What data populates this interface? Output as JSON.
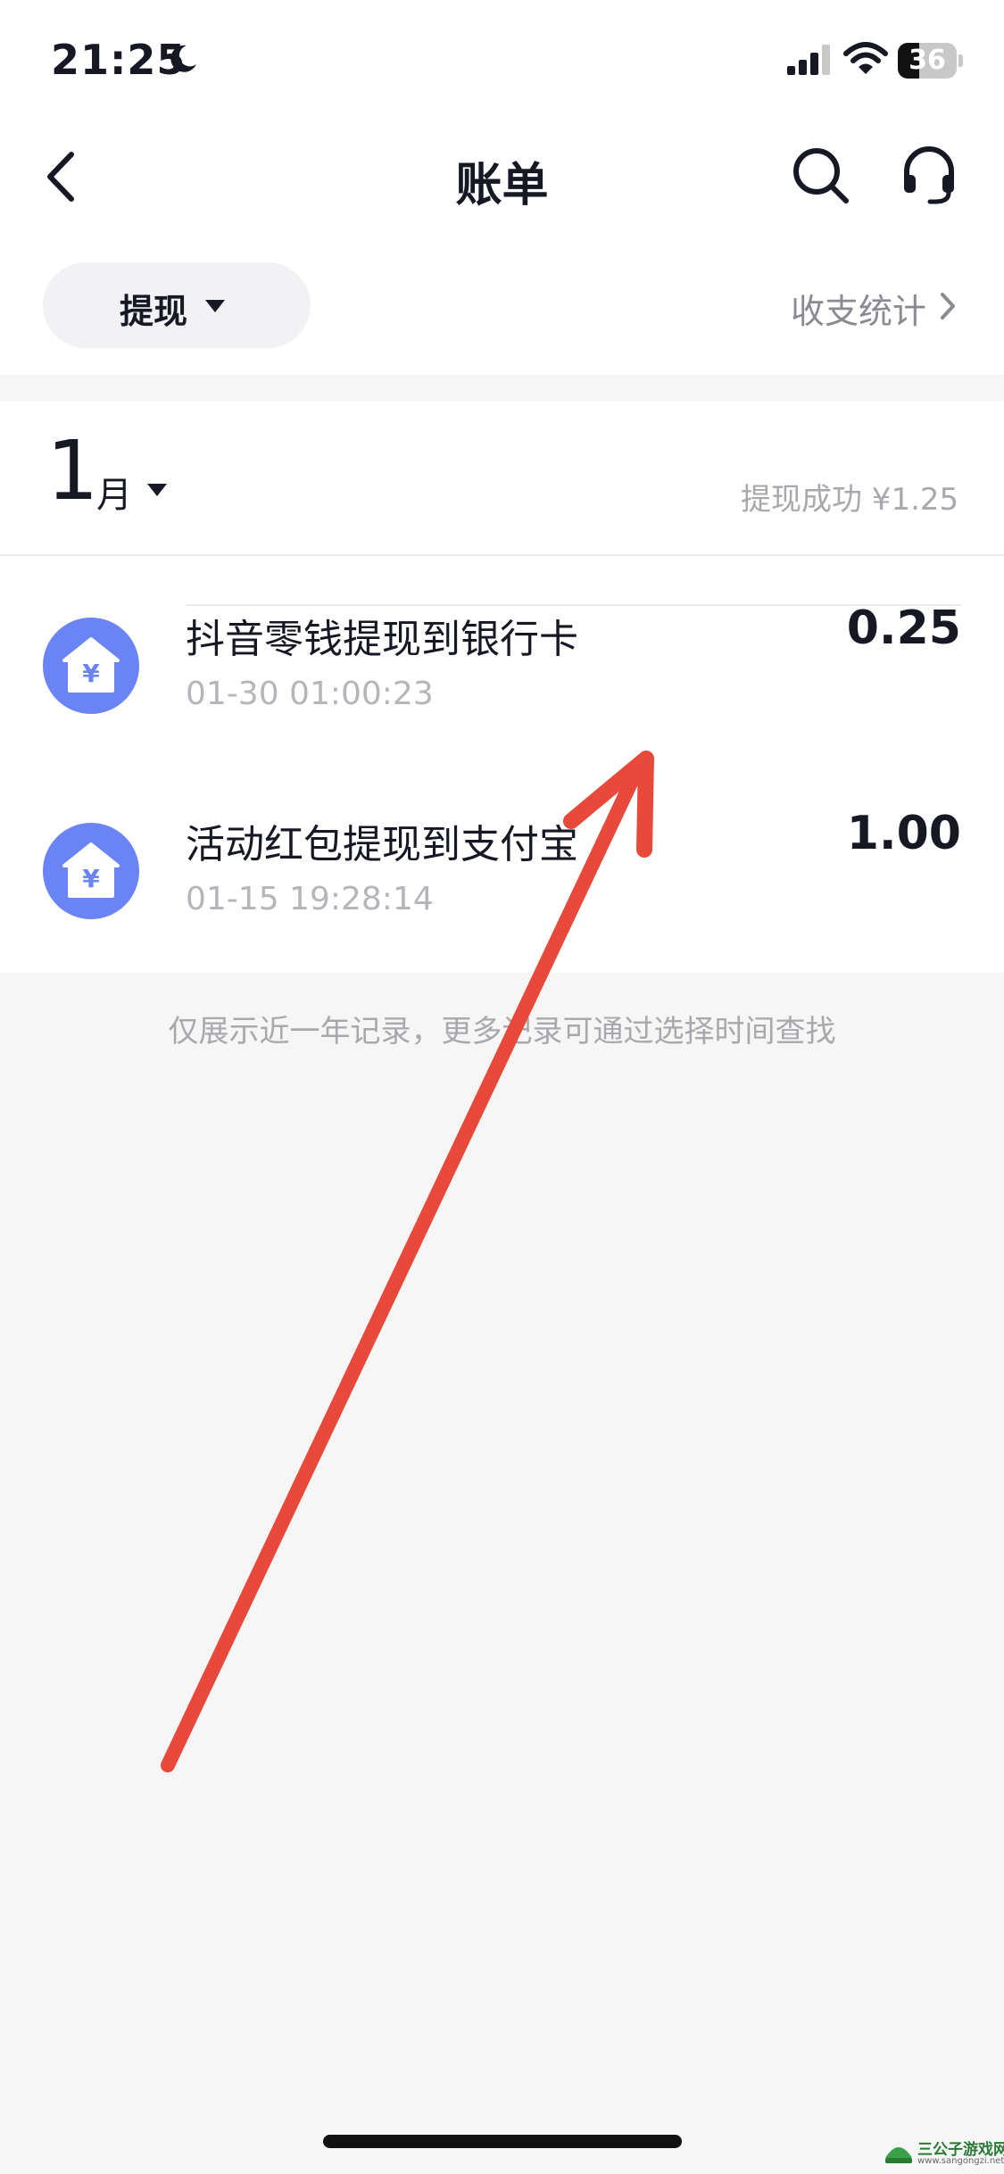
{
  "status_bar": {
    "time": "21:25",
    "battery_level": "36",
    "battery_fraction": 0.36,
    "icons": [
      "moon-icon",
      "cellular-signal-icon",
      "wifi-icon",
      "battery-icon"
    ]
  },
  "nav": {
    "title": "账单",
    "icons": [
      "back-chevron-icon",
      "search-icon",
      "headset-icon"
    ]
  },
  "filter": {
    "selected": "提现",
    "stats_label": "收支统计"
  },
  "month": {
    "number": "1",
    "unit": "月",
    "summary": "提现成功 ¥1.25"
  },
  "transactions": [
    {
      "title": "抖音零钱提现到银行卡",
      "time": "01-30 01:00:23",
      "amount": "0.25",
      "icon": "yuan-house-icon"
    },
    {
      "title": "活动红包提现到支付宝",
      "time": "01-15 19:28:14",
      "amount": "1.00",
      "icon": "yuan-house-icon"
    }
  ],
  "footnote": "仅展示近一年记录，更多记录可通过选择时间查找",
  "colors": {
    "icon_blue": "#6a83f5",
    "annotation_red": "#e8493a",
    "page_bg": "#f6f6f6",
    "muted_text": "#a8a9ad"
  },
  "watermark": {
    "name": "三公子游戏网",
    "url": "www.sangongzi.net"
  }
}
